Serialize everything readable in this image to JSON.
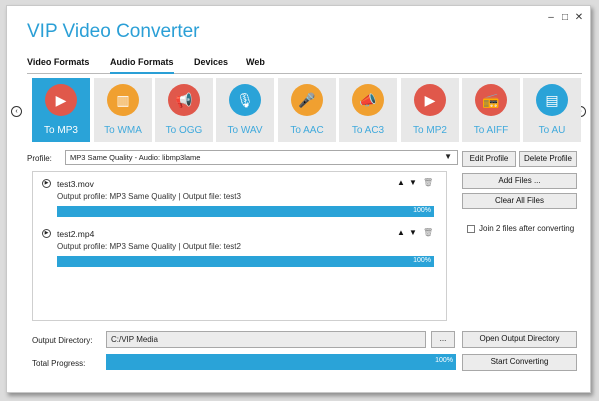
{
  "app": {
    "title": "VIP Video Converter"
  },
  "window_controls": {
    "minimize": "–",
    "maximize": "□",
    "close": "✕"
  },
  "tabs": [
    {
      "label": "Video Formats"
    },
    {
      "label": "Audio Formats"
    },
    {
      "label": "Devices"
    },
    {
      "label": "Web"
    }
  ],
  "active_tab": "Audio Formats",
  "nav": {
    "prev": "‹",
    "next": "›"
  },
  "formats": [
    {
      "label": "To MP3",
      "icon": "play-icon",
      "glyph": "▶",
      "color": "#e0584b"
    },
    {
      "label": "To WMA",
      "icon": "equalizer-icon",
      "glyph": "▥",
      "color": "#f0a030"
    },
    {
      "label": "To OGG",
      "icon": "megaphone-icon",
      "glyph": "📢",
      "color": "#e0584b"
    },
    {
      "label": "To WAV",
      "icon": "microphone-icon",
      "glyph": "🎙",
      "color": "#2aa3d8"
    },
    {
      "label": "To AAC",
      "icon": "microphone-handheld-icon",
      "glyph": "🎤",
      "color": "#f0a030"
    },
    {
      "label": "To AC3",
      "icon": "horn-icon",
      "glyph": "📣",
      "color": "#f0a030"
    },
    {
      "label": "To MP2",
      "icon": "play-icon",
      "glyph": "▶",
      "color": "#e0584b"
    },
    {
      "label": "To AIFF",
      "icon": "radio-icon",
      "glyph": "📻",
      "color": "#e0584b"
    },
    {
      "label": "To AU",
      "icon": "mixer-icon",
      "glyph": "▤",
      "color": "#2aa3d8"
    }
  ],
  "profile": {
    "label": "Profile:",
    "value": "MP3 Same Quality - Audio: libmp3lame",
    "edit_button": "Edit Profile",
    "delete_button": "Delete Profile"
  },
  "queue": [
    {
      "name": "test3.mov",
      "info": "Output profile:  MP3 Same Quality  |  Output file:  test3",
      "progress": "100%"
    },
    {
      "name": "test2.mp4",
      "info": "Output profile:  MP3 Same Quality  |  Output file:  test2",
      "progress": "100%"
    }
  ],
  "item_controls": {
    "up": "▲",
    "down": "▼",
    "delete": "🗑"
  },
  "side": {
    "add_files": "Add Files ...",
    "clear_all": "Clear All Files",
    "join_label": "Join 2 files after converting"
  },
  "output": {
    "label": "Output Directory:",
    "value": "C:/VIP Media",
    "browse": "...",
    "open_button": "Open Output Directory"
  },
  "total": {
    "label": "Total Progress:",
    "progress": "100%",
    "start_button": "Start Converting"
  }
}
